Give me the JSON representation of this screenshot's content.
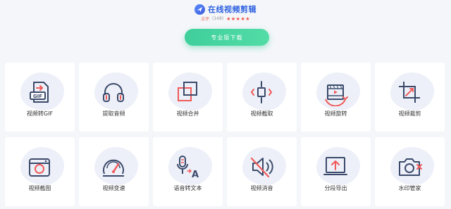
{
  "header": {
    "title": "在线视频剪辑",
    "rating_label": "点评",
    "rating_count": "(148)",
    "stars": "★★★★★"
  },
  "pro_button": {
    "label": "专业版下载"
  },
  "tools": [
    {
      "label": "视频转GIF",
      "icon": "gif-file-icon"
    },
    {
      "label": "提取音频",
      "icon": "headphones-icon"
    },
    {
      "label": "视频合并",
      "icon": "merge-squares-icon"
    },
    {
      "label": "视频截取",
      "icon": "trim-icon"
    },
    {
      "label": "视频旋转",
      "icon": "rotate-video-icon"
    },
    {
      "label": "视频裁剪",
      "icon": "crop-icon"
    },
    {
      "label": "视频截图",
      "icon": "camera-icon"
    },
    {
      "label": "视频变速",
      "icon": "speedometer-icon"
    },
    {
      "label": "语音转文本",
      "icon": "mic-to-text-icon"
    },
    {
      "label": "视频消音",
      "icon": "mute-icon"
    },
    {
      "label": "分段导出",
      "icon": "export-icon"
    },
    {
      "label": "水印管家",
      "icon": "watermark-camera-icon"
    }
  ],
  "colors": {
    "accent_blue": "#2b5fe0",
    "icon_dark": "#3b4a6b",
    "icon_red": "#f05a5a",
    "button_green": "#3fcf9c"
  }
}
